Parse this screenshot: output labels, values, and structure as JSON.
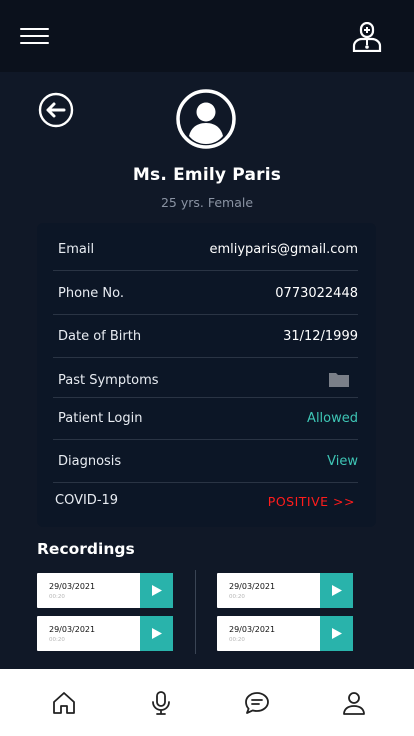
{
  "header": {
    "menu_icon": "hamburger-menu-icon",
    "doctor_icon": "doctor-icon"
  },
  "patient": {
    "name": "Ms. Emily Paris",
    "subtitle": "25 yrs. Female"
  },
  "details": {
    "email_label": "Email",
    "email_value": "emliyparis@gmail.com",
    "phone_label": "Phone No.",
    "phone_value": "0773022448",
    "dob_label": "Date of Birth",
    "dob_value": "31/12/1999",
    "past_symptoms_label": "Past Symptoms",
    "patient_login_label": "Patient Login",
    "patient_login_value": "Allowed",
    "diagnosis_label": "Diagnosis",
    "diagnosis_value": "View",
    "covid_label": "COVID-19",
    "covid_value": "POSITIVE >>"
  },
  "recordings": {
    "title": "Recordings",
    "items": [
      {
        "date": "29/03/2021",
        "duration": "00:20"
      },
      {
        "date": "29/03/2021",
        "duration": "00:20"
      },
      {
        "date": "29/03/2021",
        "duration": "00:20"
      },
      {
        "date": "29/03/2021",
        "duration": "00:20"
      }
    ]
  },
  "colors": {
    "background": "#101827",
    "card": "#0c1626",
    "accent_teal": "#29b3ab",
    "positive_red": "#ff1c1c"
  },
  "nav": [
    "home-icon",
    "microphone-icon",
    "chat-icon",
    "profile-icon"
  ]
}
